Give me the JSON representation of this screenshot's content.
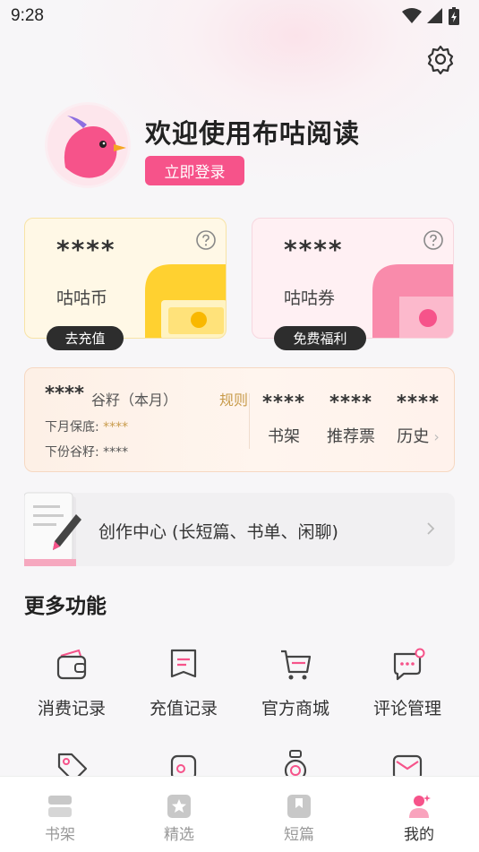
{
  "status_bar": {
    "time": "9:28"
  },
  "profile": {
    "welcome": "欢迎使用布咕阅读",
    "login_label": "立即登录"
  },
  "wallet": {
    "coin": {
      "value": "****",
      "label": "咕咕币",
      "action": "去充值"
    },
    "voucher": {
      "value": "****",
      "label": "咕咕券",
      "action": "免费福利"
    }
  },
  "stats": {
    "grain_value": "****",
    "grain_label": "谷籽（本月）",
    "rule_label": "规则",
    "floor_label": "下月保底: ",
    "floor_value": "****",
    "next_label": "下份谷籽: ",
    "next_value": "****",
    "items": [
      {
        "value": "****",
        "label": "书架"
      },
      {
        "value": "****",
        "label": "推荐票"
      },
      {
        "value": "****",
        "label": "历史"
      }
    ]
  },
  "creation": {
    "label": "创作中心 (长短篇、书单、闲聊)"
  },
  "more": {
    "title": "更多功能",
    "items": [
      {
        "label": "消费记录",
        "icon": "wallet-icon"
      },
      {
        "label": "充值记录",
        "icon": "receipt-icon"
      },
      {
        "label": "官方商城",
        "icon": "cart-icon"
      },
      {
        "label": "评论管理",
        "icon": "comment-icon"
      }
    ],
    "row2_icons": [
      "tag-icon",
      "badge-icon",
      "ring-icon",
      "mail-icon"
    ]
  },
  "tabbar": {
    "items": [
      {
        "label": "书架",
        "icon": "bookshelf-icon",
        "active": false
      },
      {
        "label": "精选",
        "icon": "star-icon",
        "active": false
      },
      {
        "label": "短篇",
        "icon": "bookmark-icon",
        "active": false
      },
      {
        "label": "我的",
        "icon": "profile-icon",
        "active": true
      }
    ]
  },
  "colors": {
    "accent": "#f6538a",
    "gold": "#c89b4b",
    "coin_card": "#fff8e6",
    "voucher_card": "#fff0f3"
  }
}
